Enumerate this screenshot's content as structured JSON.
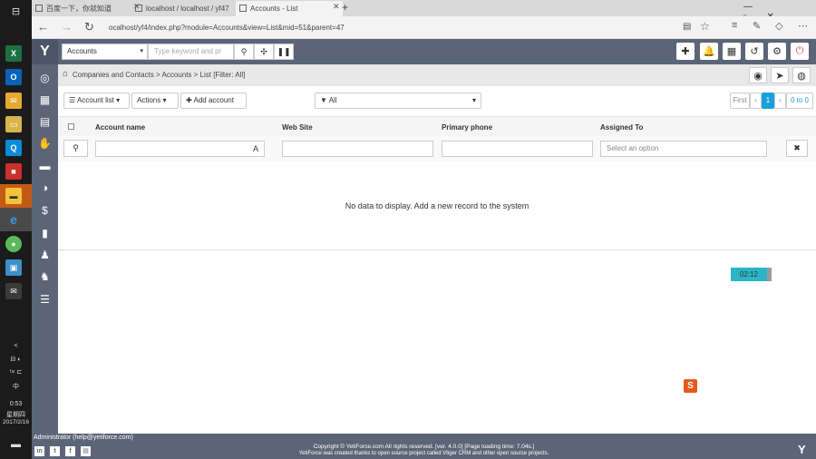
{
  "taskbar": {
    "time": "0:53",
    "date": "2017/2/16",
    "weekday": "星期四",
    "small_labels": [
      "IL",
      "L",
      "L",
      "TT"
    ],
    "misc": [
      "<",
      "L",
      "x",
      "中"
    ]
  },
  "browser": {
    "tabs": [
      {
        "title": "百度一下，你就知道"
      },
      {
        "title": "localhost / localhost / yf47"
      },
      {
        "title": "Accounts - List"
      }
    ],
    "url": "ocalhost/yf4/index.php?module=Accounts&view=List&mid=51&parent=47"
  },
  "app": {
    "module_select": "Accounts",
    "search_placeholder": "Type keyword and pr",
    "breadcrumb": "Companies and Contacts > Accounts > List [Filter: All]",
    "toolbar": {
      "list_button": "Account list",
      "actions_button": "Actions",
      "add_button": "Add account",
      "filter_value": "All"
    },
    "pagination": {
      "first": "First",
      "prev": "‹",
      "current": "1",
      "next": "›",
      "range": "0 to 0"
    },
    "columns": [
      "Account name",
      "Web Site",
      "Primary phone",
      "Assigned To"
    ],
    "assigned_placeholder": "Select an option",
    "empty_message": "No data to display. Add a new record to the system",
    "clock_widget": "02:12",
    "footer": {
      "user": "Administrator (help@yetiforce.com)",
      "copyright": "Copyright © YetiForce.com All rights reserved. [ver. 4.0.0] [Page loading time: 7.04s.]",
      "credits": "YetiForce was created thanks to open source project called Vtiger CRM and other open source projects."
    }
  },
  "colors": {
    "app_bar": "#5b6577",
    "pager_active": "#1a9fd8",
    "clock_bg": "#2cb5c5"
  }
}
